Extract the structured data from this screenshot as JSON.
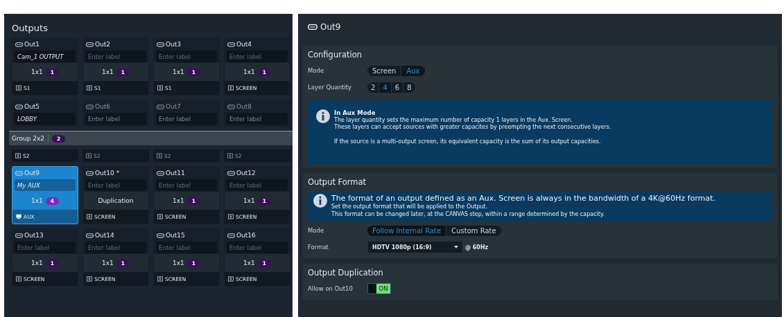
{
  "outputs_panel": {
    "title": "Outputs",
    "rows": [
      {
        "outputs": [
          {
            "name": "Out1",
            "label": "Cam_1 OUTPUT",
            "capacity": "1x1",
            "count": "1",
            "kind": "capacity",
            "footer": {
              "kind": "screen",
              "text": "S1"
            },
            "selected": false,
            "disabled": false
          },
          {
            "name": "Out2",
            "placeholder": "Enter label",
            "capacity": "1x1",
            "count": "1",
            "kind": "capacity",
            "footer": {
              "kind": "screen",
              "text": "S1"
            },
            "selected": false,
            "disabled": false
          },
          {
            "name": "Out3",
            "placeholder": "Enter label",
            "capacity": "1x1",
            "count": "1",
            "kind": "capacity",
            "footer": {
              "kind": "screen",
              "text": "S1"
            },
            "selected": false,
            "disabled": false
          },
          {
            "name": "Out4",
            "placeholder": "Enter label",
            "capacity": "1x1",
            "count": "1",
            "kind": "capacity",
            "footer": {
              "kind": "screen",
              "text": "SCREEN"
            },
            "selected": false,
            "disabled": false
          }
        ]
      },
      {
        "group": {
          "label": "Group 2x2",
          "count": "2"
        },
        "outputs": [
          {
            "name": "Out5",
            "label": "LOBBY",
            "footer": {
              "kind": "screen",
              "text": "S2"
            },
            "selected": false,
            "disabled": false
          },
          {
            "name": "Out6",
            "placeholder": "Enter label",
            "footer": {
              "kind": "screen",
              "text": "S2"
            },
            "selected": false,
            "disabled": true
          },
          {
            "name": "Out7",
            "placeholder": "Enter label",
            "footer": {
              "kind": "screen",
              "text": "S2"
            },
            "selected": false,
            "disabled": true
          },
          {
            "name": "Out8",
            "placeholder": "Enter label",
            "footer": {
              "kind": "screen",
              "text": "S2"
            },
            "selected": false,
            "disabled": true
          }
        ]
      },
      {
        "outputs": [
          {
            "name": "Out9",
            "label": "My AUX",
            "capacity": "1x1",
            "count": "4",
            "kind": "capacity",
            "footer": {
              "kind": "aux",
              "text": "AUX"
            },
            "selected": true,
            "disabled": false
          },
          {
            "name": "Out10 *",
            "placeholder": "Enter label",
            "kind": "text",
            "middle": "Duplication",
            "footer": {
              "kind": "screen",
              "text": "SCREEN"
            },
            "selected": false,
            "disabled": false
          },
          {
            "name": "Out11",
            "placeholder": "Enter label",
            "capacity": "1x1",
            "count": "1",
            "kind": "capacity",
            "footer": {
              "kind": "screen",
              "text": "SCREEN"
            },
            "selected": false,
            "disabled": false
          },
          {
            "name": "Out12",
            "placeholder": "Enter label",
            "capacity": "1x1",
            "count": "1",
            "kind": "capacity",
            "footer": {
              "kind": "screen",
              "text": "SCREEN"
            },
            "selected": false,
            "disabled": false
          }
        ]
      },
      {
        "outputs": [
          {
            "name": "Out13",
            "placeholder": "Enter label",
            "capacity": "1x1",
            "count": "1",
            "kind": "capacity",
            "footer": {
              "kind": "screen",
              "text": "SCREEN"
            },
            "selected": false,
            "disabled": false
          },
          {
            "name": "Out14",
            "placeholder": "Enter label",
            "capacity": "1x1",
            "count": "1",
            "kind": "capacity",
            "footer": {
              "kind": "screen",
              "text": "SCREEN"
            },
            "selected": false,
            "disabled": false
          },
          {
            "name": "Out15",
            "placeholder": "Enter label",
            "capacity": "1x1",
            "count": "1",
            "kind": "capacity",
            "footer": {
              "kind": "screen",
              "text": "SCREEN"
            },
            "selected": false,
            "disabled": false
          },
          {
            "name": "Out16",
            "placeholder": "Enter label",
            "capacity": "1x1",
            "count": "1",
            "kind": "capacity",
            "footer": {
              "kind": "screen",
              "text": "SCREEN"
            },
            "selected": false,
            "disabled": false
          }
        ]
      }
    ]
  },
  "detail_panel": {
    "title": "Out9",
    "configuration": {
      "title": "Configuration",
      "mode_label": "Mode",
      "modes": [
        {
          "label": "Screen",
          "selected": false
        },
        {
          "label": "Aux",
          "selected": true
        }
      ],
      "layer_label": "Layer Quantity",
      "layers": [
        {
          "label": "2",
          "selected": false
        },
        {
          "label": "4",
          "selected": true
        },
        {
          "label": "6",
          "selected": false
        },
        {
          "label": "8",
          "selected": false
        }
      ],
      "info": {
        "title": "In Aux Mode",
        "lines": [
          "The layer quantity sets the maximum number of capacity 1 layers in the Aux. Screen.",
          "These layers can accept sources with greater capacites by preempting the next consecutive layers."
        ],
        "note": "If the source is a multi-output screen, its equivalent capacity is the sum of its output capacities."
      }
    },
    "output_format": {
      "title": "Output Format",
      "info": {
        "headline": "The format of an output defined as an Aux. Screen is always in the bandwidth of a 4K@60Hz format.",
        "lines": [
          "Set the output format that will be applied to the Output.",
          "This format can be changed later, at the CANVAS step, within a range determined by the capacity."
        ]
      },
      "mode_label": "Mode",
      "modes": [
        {
          "label": "Follow Internal Rate",
          "selected": true
        },
        {
          "label": "Custom Rate",
          "selected": false
        }
      ],
      "format_label": "Format",
      "format_value": "HDTV 1080p (16:9)",
      "rate": "@ 60Hz"
    },
    "output_duplication": {
      "title": "Output Duplication",
      "allow_label": "Allow on Out10",
      "toggle": {
        "on": true,
        "label": "ON"
      }
    }
  }
}
